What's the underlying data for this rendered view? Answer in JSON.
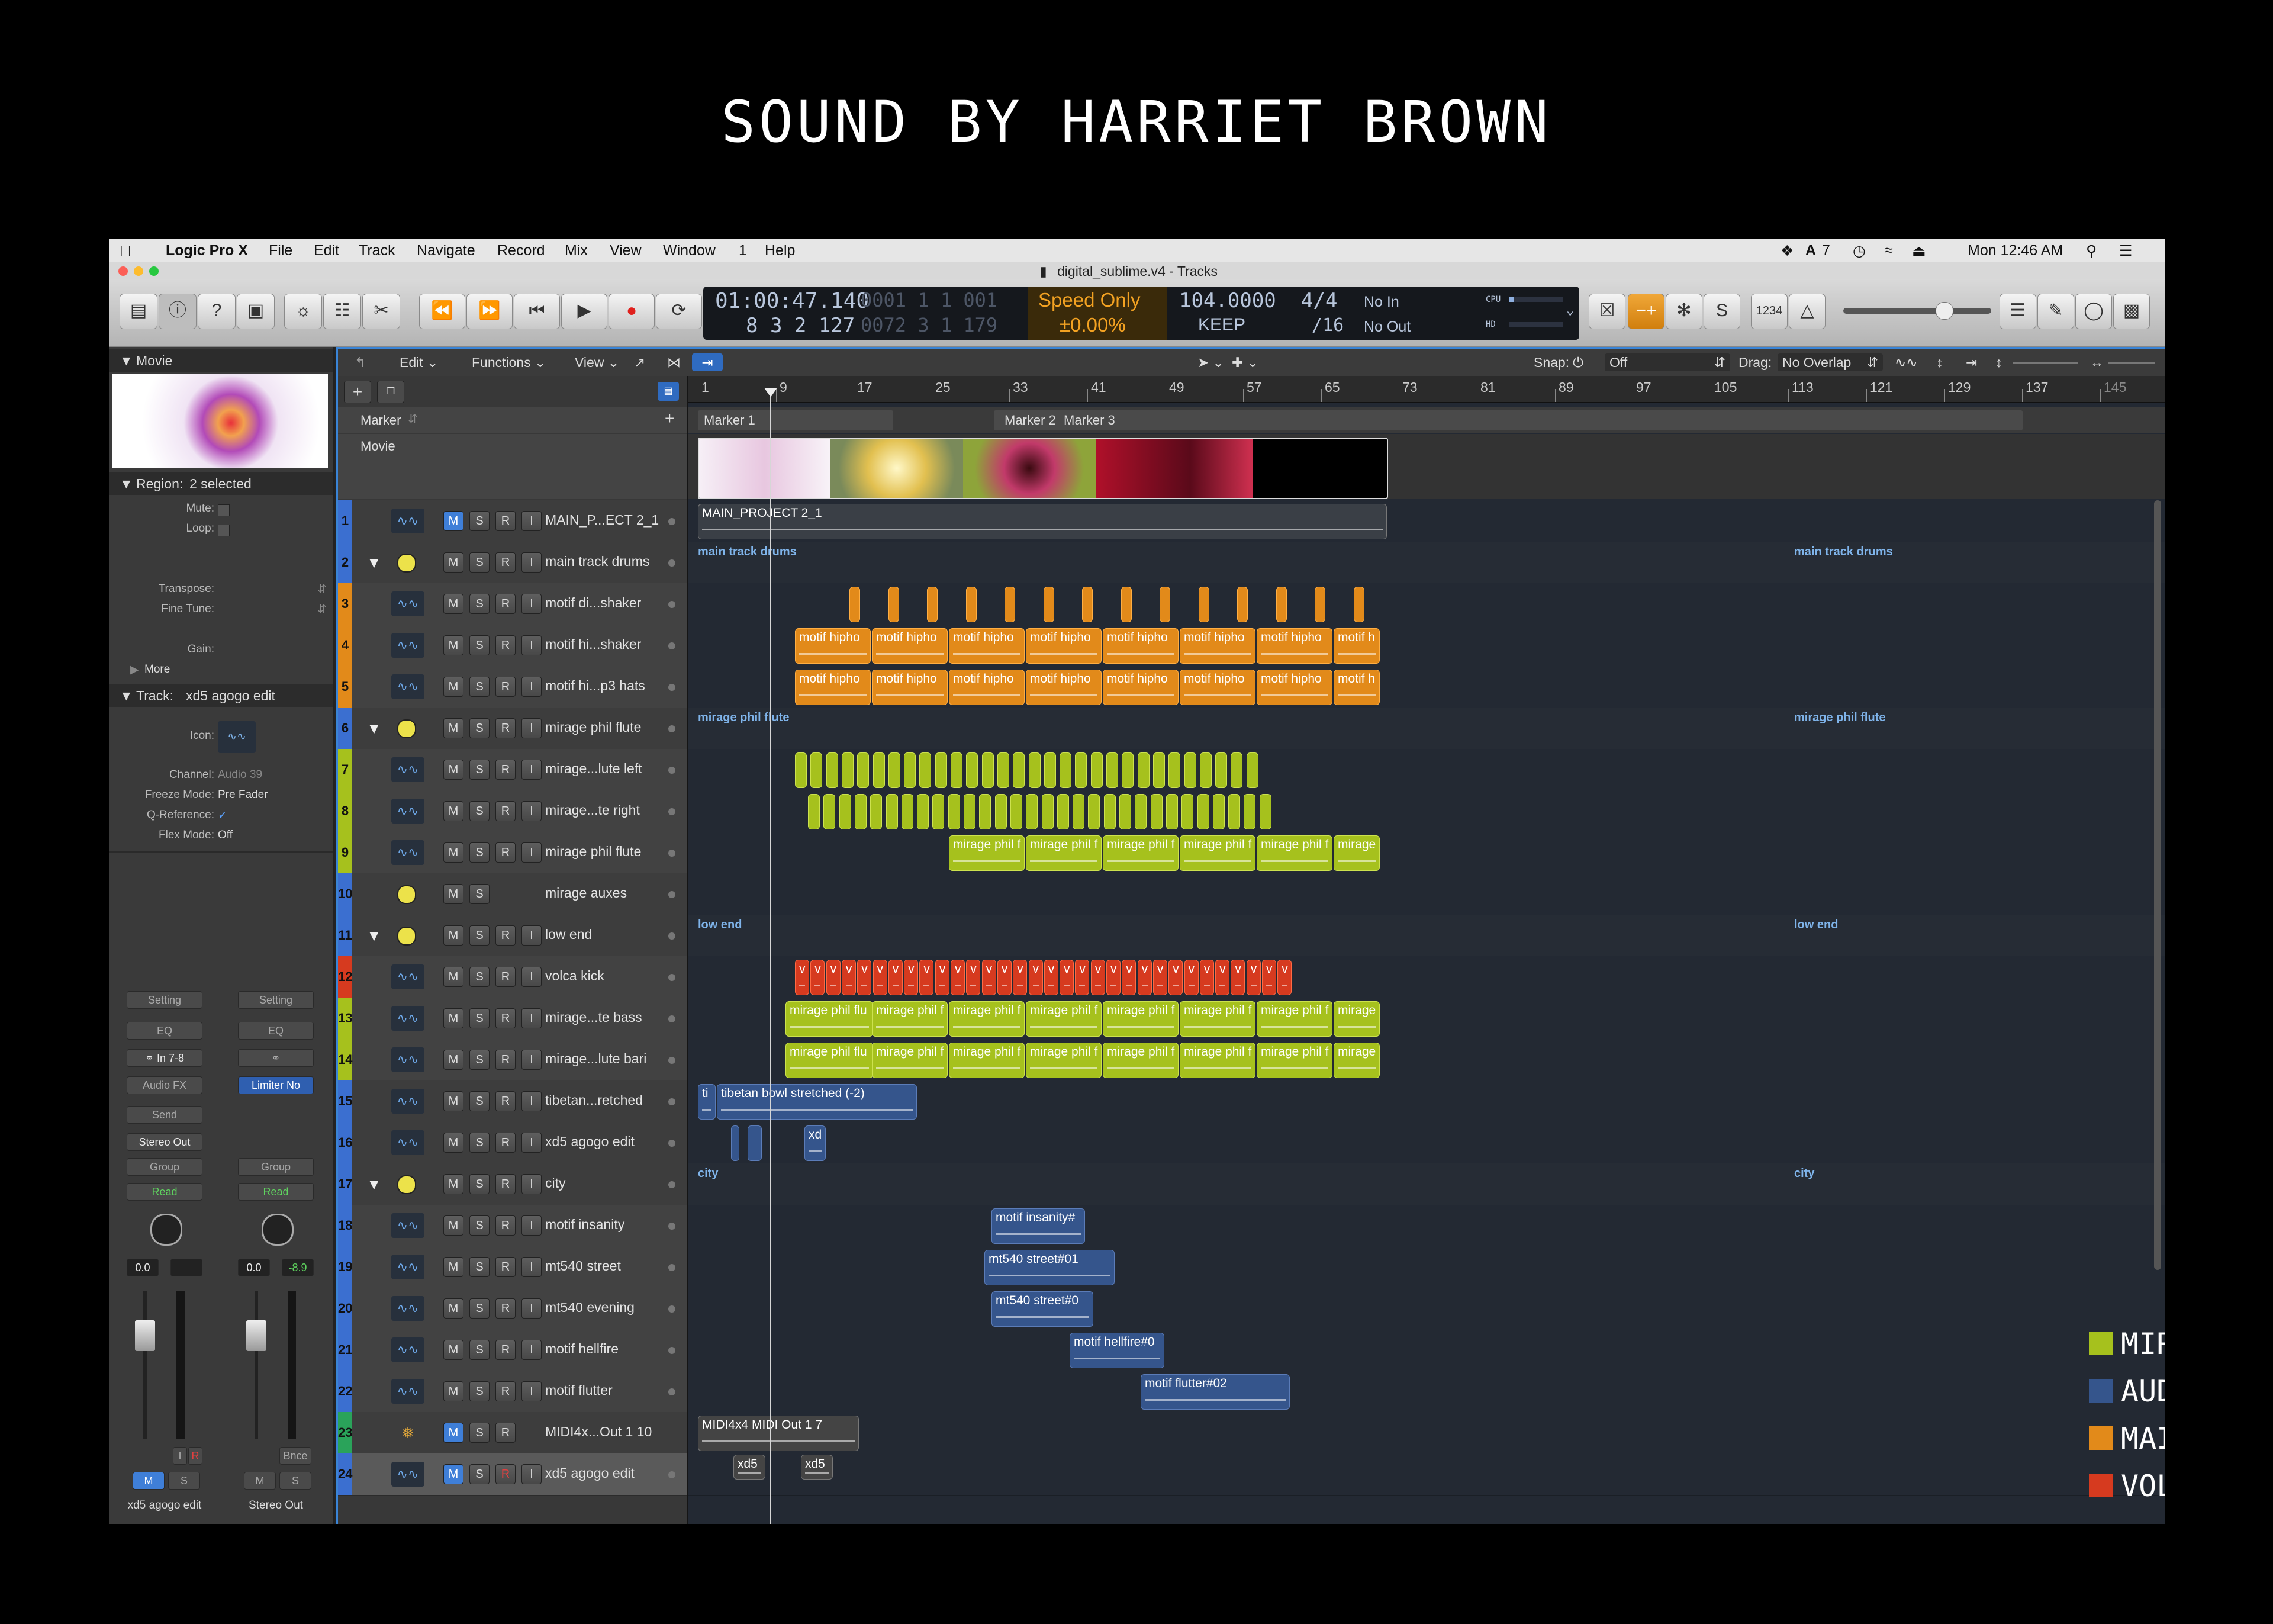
{
  "poster": {
    "title": "SOUND BY HARRIET BROWN"
  },
  "menubar": {
    "app_name": "Logic Pro X",
    "items": [
      "File",
      "Edit",
      "Track",
      "Navigate",
      "Record",
      "Mix",
      "View",
      "Window",
      "1",
      "Help"
    ],
    "status": {
      "adobe_count": "7",
      "clock": "Mon 12:46 AM"
    }
  },
  "window": {
    "title": "digital_sublime.v4 - Tracks"
  },
  "lcd": {
    "time": "01:00:47.140",
    "bars": "8  3  2  127",
    "bars_dim_top": "0001  1  1  001",
    "bars_dim_bottom": "0072  3  1  179",
    "mode": "Speed Only",
    "mode_value": "±0.00%",
    "tempo": "104.0000",
    "tempo_mode": "KEEP",
    "signature": "4/4",
    "division": "/16",
    "midi_in": "No In",
    "midi_out": "No Out",
    "cpu_label": "CPU",
    "hd_label": "HD"
  },
  "controlbar": {
    "count_in": "1234"
  },
  "localbar": {
    "edit": "Edit",
    "functions": "Functions",
    "view": "View",
    "snap_label": "Snap:",
    "snap_value": "Off",
    "drag_label": "Drag:",
    "drag_value": "No Overlap"
  },
  "ruler": {
    "bars": [
      "1",
      "9",
      "17",
      "25",
      "33",
      "41",
      "49",
      "57",
      "65",
      "73",
      "81",
      "89",
      "97",
      "105",
      "113",
      "121",
      "129",
      "137",
      "145"
    ]
  },
  "global_tracks": {
    "marker_label": "Marker",
    "movie_label": "Movie",
    "markers": [
      "Marker 1",
      "Marker 2",
      "Marker 3"
    ]
  },
  "inspector": {
    "movie_header": "Movie",
    "region_header": "Region:",
    "region_value": "2 selected",
    "region_params": [
      "Mute:",
      "Loop:",
      "Transpose:",
      "Fine Tune:",
      "Gain:"
    ],
    "more": "More",
    "track_header": "Track:",
    "track_value": "xd5 agogo edit",
    "track_params": [
      {
        "k": "Icon:",
        "v": ""
      },
      {
        "k": "Channel:",
        "v": "Audio 39"
      },
      {
        "k": "Freeze Mode:",
        "v": "Pre Fader"
      },
      {
        "k": "Q-Reference:",
        "v": "✓"
      },
      {
        "k": "Flex Mode:",
        "v": "Off"
      }
    ],
    "strips": [
      {
        "setting": "Setting",
        "eq": "EQ",
        "input": "In 7-8",
        "fx": "Audio FX",
        "send": "Send",
        "output": "Stereo Out",
        "group": "Group",
        "automation": "Read",
        "pan_value": "0.0",
        "level": "",
        "m": "M",
        "s": "S",
        "name": "xd5 agogo edit"
      },
      {
        "setting": "Setting",
        "eq": "EQ",
        "input": "",
        "fx": "Limiter No",
        "send": "",
        "output": "",
        "group": "Group",
        "automation": "Read",
        "pan_value": "0.0",
        "level": "-8.9",
        "m": "M",
        "s": "S",
        "name": "Stereo Out",
        "bounce": "Bnce"
      }
    ],
    "strip_ir": [
      "I",
      "R"
    ]
  },
  "tracks": [
    {
      "n": "1",
      "name": "MAIN_P...ECT 2_1",
      "color": "#3b6fd0",
      "kind": "audio",
      "buttons": [
        "M",
        "S",
        "R",
        "I"
      ]
    },
    {
      "n": "2",
      "name": "main track drums",
      "color": "#3b6fd0",
      "kind": "folder",
      "buttons": [
        "M",
        "S",
        "R",
        "I"
      ]
    },
    {
      "n": "3",
      "name": "motif di...shaker",
      "color": "#e28a1a",
      "kind": "sub",
      "buttons": [
        "M",
        "S",
        "R",
        "I"
      ]
    },
    {
      "n": "4",
      "name": "motif hi...shaker",
      "color": "#e28a1a",
      "kind": "sub",
      "buttons": [
        "M",
        "S",
        "R",
        "I"
      ]
    },
    {
      "n": "5",
      "name": "motif hi...p3 hats",
      "color": "#e28a1a",
      "kind": "sub",
      "buttons": [
        "M",
        "S",
        "R",
        "I"
      ]
    },
    {
      "n": "6",
      "name": "mirage phil flute",
      "color": "#3b6fd0",
      "kind": "folder",
      "buttons": [
        "M",
        "S",
        "R",
        "I"
      ]
    },
    {
      "n": "7",
      "name": "mirage...lute left",
      "color": "#a6c11d",
      "kind": "sub",
      "buttons": [
        "M",
        "S",
        "R",
        "I"
      ]
    },
    {
      "n": "8",
      "name": "mirage...te right",
      "color": "#a6c11d",
      "kind": "sub",
      "buttons": [
        "M",
        "S",
        "R",
        "I"
      ]
    },
    {
      "n": "9",
      "name": "mirage phil flute",
      "color": "#a6c11d",
      "kind": "sub",
      "buttons": [
        "M",
        "S",
        "R",
        "I"
      ]
    },
    {
      "n": "10",
      "name": "mirage auxes",
      "color": "#3b6fd0",
      "kind": "aux",
      "buttons": [
        "M",
        "S"
      ]
    },
    {
      "n": "11",
      "name": "low end",
      "color": "#3b6fd0",
      "kind": "folder",
      "buttons": [
        "M",
        "S",
        "R",
        "I"
      ]
    },
    {
      "n": "12",
      "name": "volca kick",
      "color": "#d63a1f",
      "kind": "sub",
      "buttons": [
        "M",
        "S",
        "R",
        "I"
      ]
    },
    {
      "n": "13",
      "name": "mirage...te bass",
      "color": "#a6c11d",
      "kind": "sub",
      "buttons": [
        "M",
        "S",
        "R",
        "I"
      ]
    },
    {
      "n": "14",
      "name": "mirage...lute bari",
      "color": "#a6c11d",
      "kind": "sub",
      "buttons": [
        "M",
        "S",
        "R",
        "I"
      ]
    },
    {
      "n": "15",
      "name": "tibetan...retched",
      "color": "#3b6fd0",
      "kind": "audio",
      "buttons": [
        "M",
        "S",
        "R",
        "I"
      ]
    },
    {
      "n": "16",
      "name": "xd5 agogo edit",
      "color": "#3b6fd0",
      "kind": "audio",
      "buttons": [
        "M",
        "S",
        "R",
        "I"
      ]
    },
    {
      "n": "17",
      "name": "city",
      "color": "#3b6fd0",
      "kind": "folder",
      "buttons": [
        "M",
        "S",
        "R",
        "I"
      ]
    },
    {
      "n": "18",
      "name": "motif insanity",
      "color": "#3b6fd0",
      "kind": "sub",
      "buttons": [
        "M",
        "S",
        "R",
        "I"
      ]
    },
    {
      "n": "19",
      "name": "mt540 street",
      "color": "#3b6fd0",
      "kind": "sub",
      "buttons": [
        "M",
        "S",
        "R",
        "I"
      ]
    },
    {
      "n": "20",
      "name": "mt540 evening",
      "color": "#3b6fd0",
      "kind": "sub",
      "buttons": [
        "M",
        "S",
        "R",
        "I"
      ]
    },
    {
      "n": "21",
      "name": "motif hellfire",
      "color": "#3b6fd0",
      "kind": "sub",
      "buttons": [
        "M",
        "S",
        "R",
        "I"
      ]
    },
    {
      "n": "22",
      "name": "motif flutter",
      "color": "#3b6fd0",
      "kind": "sub",
      "buttons": [
        "M",
        "S",
        "R",
        "I"
      ]
    },
    {
      "n": "23",
      "name": "MIDI4x...Out 1 10",
      "color": "#2aa35a",
      "kind": "midi",
      "buttons": [
        "M",
        "S",
        "R"
      ]
    },
    {
      "n": "24",
      "name": "xd5 agogo edit",
      "color": "#3b6fd0",
      "kind": "audio",
      "buttons": [
        "M",
        "S",
        "R",
        "I"
      ]
    }
  ],
  "regions": {
    "main_project": "MAIN_PROJECT 2_1",
    "folder_labels": {
      "main_drums": "main track drums",
      "mirage": "mirage phil flute",
      "low_end": "low end",
      "city": "city"
    },
    "motif_hiphop": "motif hipho",
    "motif_hiphop_last": "motif h",
    "mirage_flute": "mirage phil f",
    "mirage_flute_last": "mirage",
    "mirage_flute_first13": "mirage phil flu",
    "kick": "v",
    "tibetan_short": "ti",
    "tibetan": "tibetan bowl stretched (-2)",
    "xd": "xd",
    "motif_insanity": "motif insanity#",
    "mt540_street": "mt540 street#01",
    "mt540_evening": "mt540 street#0",
    "motif_hellfire": "motif hellfire#0",
    "motif_flutter": "motif flutter#02",
    "midi_out": "MIDI4x4 MIDI Out 1 7",
    "xd5": "xd5"
  },
  "legend": [
    {
      "label": "MIRAGE PHIL FLUTE",
      "color": "#a6c11d"
    },
    {
      "label": "AUDIO SAMPLES",
      "color": "#35558c"
    },
    {
      "label": "MAIN TRACK DRUMS",
      "color": "#e28a1a"
    },
    {
      "label": "VOLCA KICK DRUM",
      "color": "#d63a1f"
    }
  ]
}
